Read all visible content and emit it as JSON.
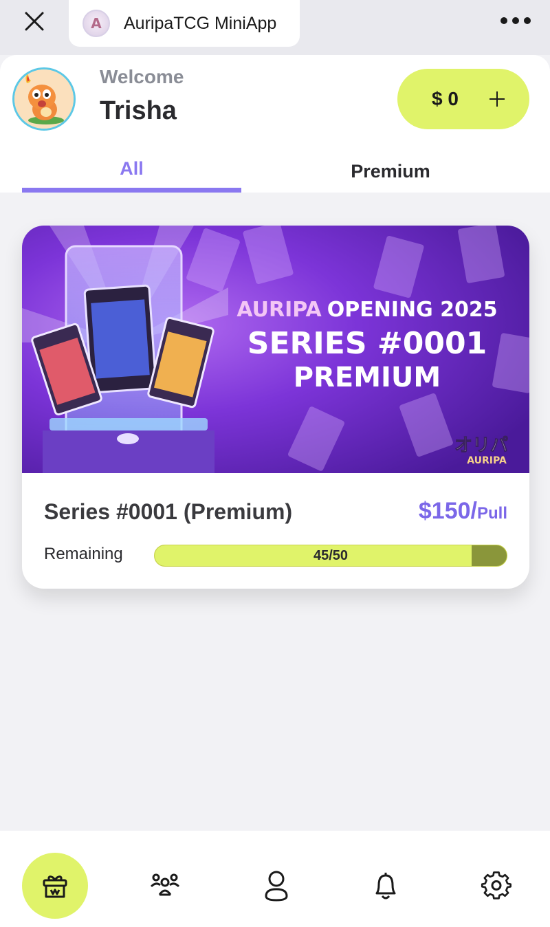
{
  "topbar": {
    "close_icon": "close-icon",
    "app_logo_letter": "A",
    "app_title": "AuripaTCG MiniApp",
    "more_icon": "more-horizontal-icon"
  },
  "header": {
    "welcome_label": "Welcome",
    "username": "Trisha",
    "balance": "$ 0",
    "add_funds_icon": "plus-icon"
  },
  "tabs": [
    {
      "label": "All",
      "active": true
    },
    {
      "label": "Premium",
      "active": false
    }
  ],
  "series": {
    "banner": {
      "line1_a": "AURIPA",
      "line1_b": "OPENING 2025",
      "line2": "SERIES #0001",
      "line3": "PREMIUM",
      "logo_jp": "オリパ",
      "logo_en": "AURIPA"
    },
    "title": "Series #0001 (Premium)",
    "price": "$150/",
    "price_unit": "Pull",
    "remaining_label": "Remaining",
    "remaining_text": "45/50",
    "remaining_fraction": 0.9
  },
  "bottom_nav": [
    {
      "icon": "gift-box-icon",
      "active": true
    },
    {
      "icon": "users-group-icon",
      "active": false
    },
    {
      "icon": "profile-icon",
      "active": false
    },
    {
      "icon": "bell-icon",
      "active": false
    },
    {
      "icon": "settings-icon",
      "active": false
    }
  ],
  "colors": {
    "accent_purple": "#8a78f0",
    "accent_lime": "#e0f36a",
    "price_purple": "#7b67e8"
  }
}
